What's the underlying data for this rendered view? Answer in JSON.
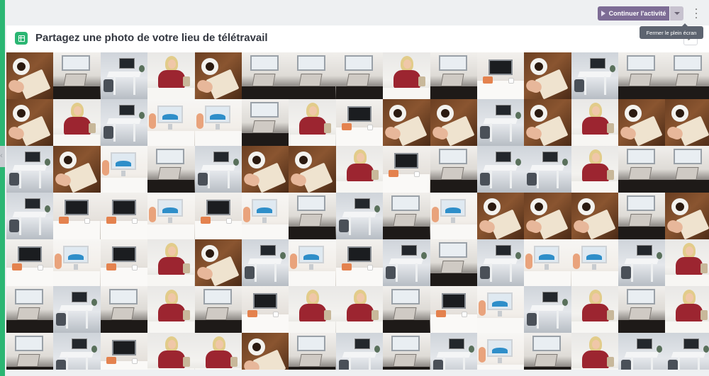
{
  "toolbar": {
    "continue_label": "Continuer l'activité"
  },
  "header": {
    "title": "Partagez une photo de votre lieu de télétravail",
    "exit_fullscreen_tooltip": "Fermer le plein écran"
  },
  "colors": {
    "accent": "#2bb673",
    "button": "#7d6c95"
  },
  "mosaic": {
    "rows": [
      [
        "coffee",
        "laptop",
        "white",
        "woman",
        "coffee",
        "laptop",
        "laptop",
        "laptop",
        "woman",
        "laptop",
        "dark",
        "coffee",
        "white",
        "laptop",
        "laptop"
      ],
      [
        "coffee",
        "woman",
        "white",
        "imac",
        "imac",
        "laptop",
        "woman",
        "dark",
        "coffee",
        "coffee",
        "white",
        "coffee",
        "woman",
        "coffee",
        "coffee"
      ],
      [
        "white",
        "coffee",
        "imac",
        "laptop",
        "white",
        "coffee",
        "coffee",
        "woman",
        "dark",
        "laptop",
        "white",
        "white",
        "woman",
        "laptop",
        "laptop"
      ],
      [
        "white",
        "dark",
        "dark",
        "imac",
        "dark",
        "imac",
        "laptop",
        "white",
        "laptop",
        "imac",
        "coffee",
        "coffee",
        "coffee",
        "laptop",
        "coffee"
      ],
      [
        "dark",
        "imac",
        "dark",
        "woman",
        "coffee",
        "white",
        "imac",
        "dark",
        "white",
        "laptop",
        "white",
        "imac",
        "imac",
        "white",
        "woman"
      ],
      [
        "laptop",
        "white",
        "laptop",
        "woman",
        "laptop",
        "dark",
        "woman",
        "woman",
        "laptop",
        "dark",
        "imac",
        "white",
        "woman",
        "laptop",
        "woman"
      ],
      [
        "laptop",
        "white",
        "dark",
        "woman",
        "woman",
        "coffee",
        "laptop",
        "white",
        "laptop",
        "white",
        "imac",
        "laptop",
        "woman",
        "white",
        "white"
      ]
    ]
  }
}
